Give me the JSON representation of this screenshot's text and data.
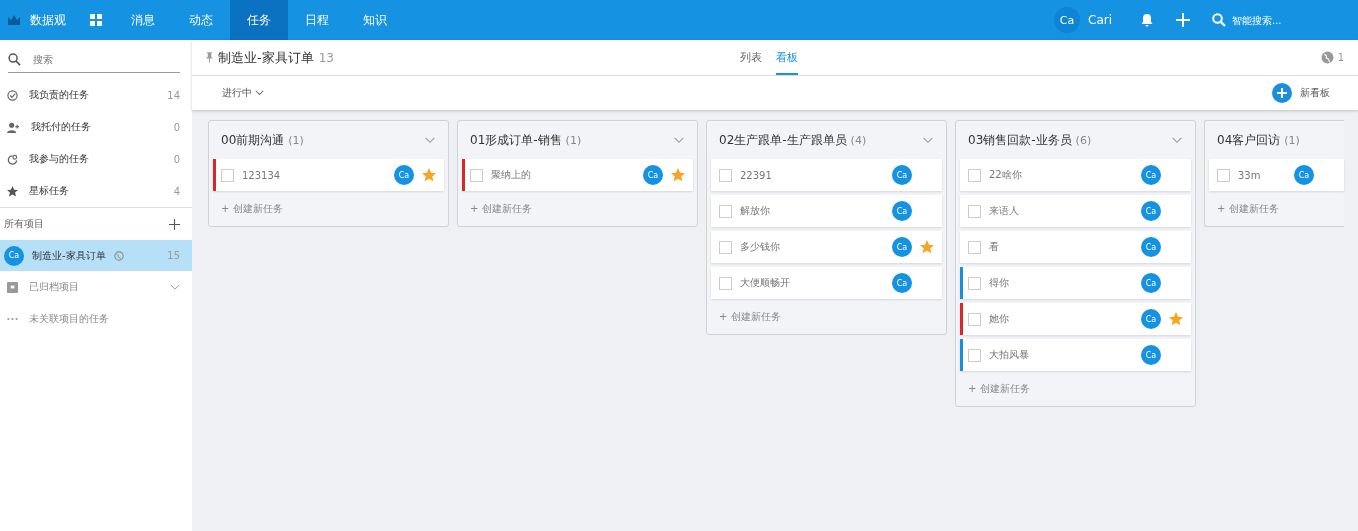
{
  "topbar": {
    "brand": "数据观",
    "nav": [
      {
        "label": "消息",
        "selected": false
      },
      {
        "label": "动态",
        "selected": false
      },
      {
        "label": "任务",
        "selected": true
      },
      {
        "label": "日程",
        "selected": false
      },
      {
        "label": "知识",
        "selected": false
      }
    ],
    "user": {
      "initials": "Ca",
      "name": "Cari"
    },
    "search": {
      "placeholder": "智能搜索..."
    }
  },
  "sidebar": {
    "search": {
      "placeholder": "搜索"
    },
    "items": [
      {
        "kind": "check",
        "label": "我负责的任务",
        "count": "14"
      },
      {
        "kind": "person",
        "label": "我托付的任务",
        "count": "0"
      },
      {
        "kind": "join",
        "label": "我参与的任务",
        "count": "0"
      },
      {
        "kind": "star",
        "label": "星标任务",
        "count": "4"
      }
    ],
    "projects_label": "所有项目",
    "projects": [
      {
        "initials": "Ca",
        "label": "制造业-家具订单",
        "count": "15",
        "selected": true
      }
    ],
    "archived": "已归档项目",
    "unlinked": "未关联项目的任务"
  },
  "header": {
    "title": "制造业-家具订单",
    "count": "13",
    "views": [
      {
        "label": "列表",
        "selected": false
      },
      {
        "label": "看板",
        "selected": true
      }
    ],
    "members": "1",
    "filter": "进行中",
    "new_board": "新看板"
  },
  "board": {
    "columns": [
      {
        "title": "00前期沟通",
        "count": "(1)",
        "add": "+ 创建新任务",
        "tasks": [
          {
            "title": "123134",
            "initials": "Ca",
            "starred": true,
            "checked": false,
            "color": "#d9262c"
          }
        ]
      },
      {
        "title": "01形成订单-销售",
        "count": "(1)",
        "add": "+ 创建新任务",
        "tasks": [
          {
            "title": "聚纳上的",
            "initials": "Ca",
            "starred": true,
            "checked": false,
            "color": "#d9262c"
          }
        ]
      },
      {
        "title": "02生产跟单-生产跟单员",
        "count": "(4)",
        "add": "+ 创建新任务",
        "tasks": [
          {
            "title": "22391",
            "initials": "Ca",
            "starred": false,
            "checked": false
          },
          {
            "title": "解放你",
            "initials": "Ca",
            "starred": false,
            "checked": false
          },
          {
            "title": "多少钱你",
            "initials": "Ca",
            "starred": true,
            "checked": false
          },
          {
            "title": "大便顺畅开",
            "initials": "Ca",
            "starred": false,
            "checked": false
          }
        ]
      },
      {
        "title": "03销售回款-业务员",
        "count": "(6)",
        "add": "+ 创建新任务",
        "tasks": [
          {
            "title": "22啥你",
            "initials": "Ca",
            "starred": false,
            "checked": false
          },
          {
            "title": "来语人",
            "initials": "Ca",
            "starred": false,
            "checked": false
          },
          {
            "title": "看",
            "initials": "Ca",
            "starred": false,
            "checked": false
          },
          {
            "title": "得你",
            "initials": "Ca",
            "starred": false,
            "checked": false,
            "color": "#1a8fe0"
          },
          {
            "title": "她你",
            "initials": "Ca",
            "starred": true,
            "checked": false,
            "color": "#d9262c"
          },
          {
            "title": "大拍风暴",
            "initials": "Ca",
            "starred": false,
            "checked": false,
            "color": "#1a8fe0"
          }
        ]
      },
      {
        "title": "04客户回访",
        "count": "(1)",
        "add": "+ 创建新任务",
        "tasks": [
          {
            "title": "33m",
            "initials": "Ca",
            "starred": false,
            "checked": false
          }
        ]
      }
    ]
  }
}
